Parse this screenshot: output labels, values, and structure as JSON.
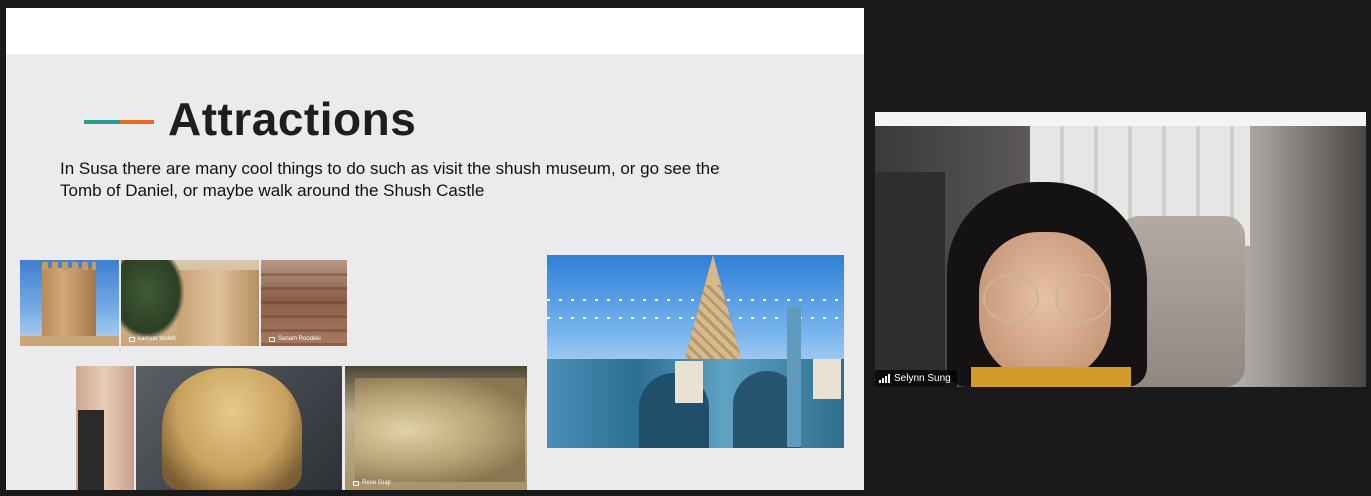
{
  "slide": {
    "title": "Attractions",
    "body": "In Susa there are many cool things to do such as visit the shush museum, or go see the Tomb of Daniel, or maybe walk around the Shush Castle",
    "accent_colors": [
      "#2a9d8f",
      "#e86a1c"
    ],
    "photo_credits": {
      "castle_wall": "kamyar tooleh",
      "brick_wall": "Sanam Roodeki",
      "relief": "Rene Gugl"
    }
  },
  "participant": {
    "name": "Selynn Sung",
    "icon": "signal-bars-icon"
  }
}
